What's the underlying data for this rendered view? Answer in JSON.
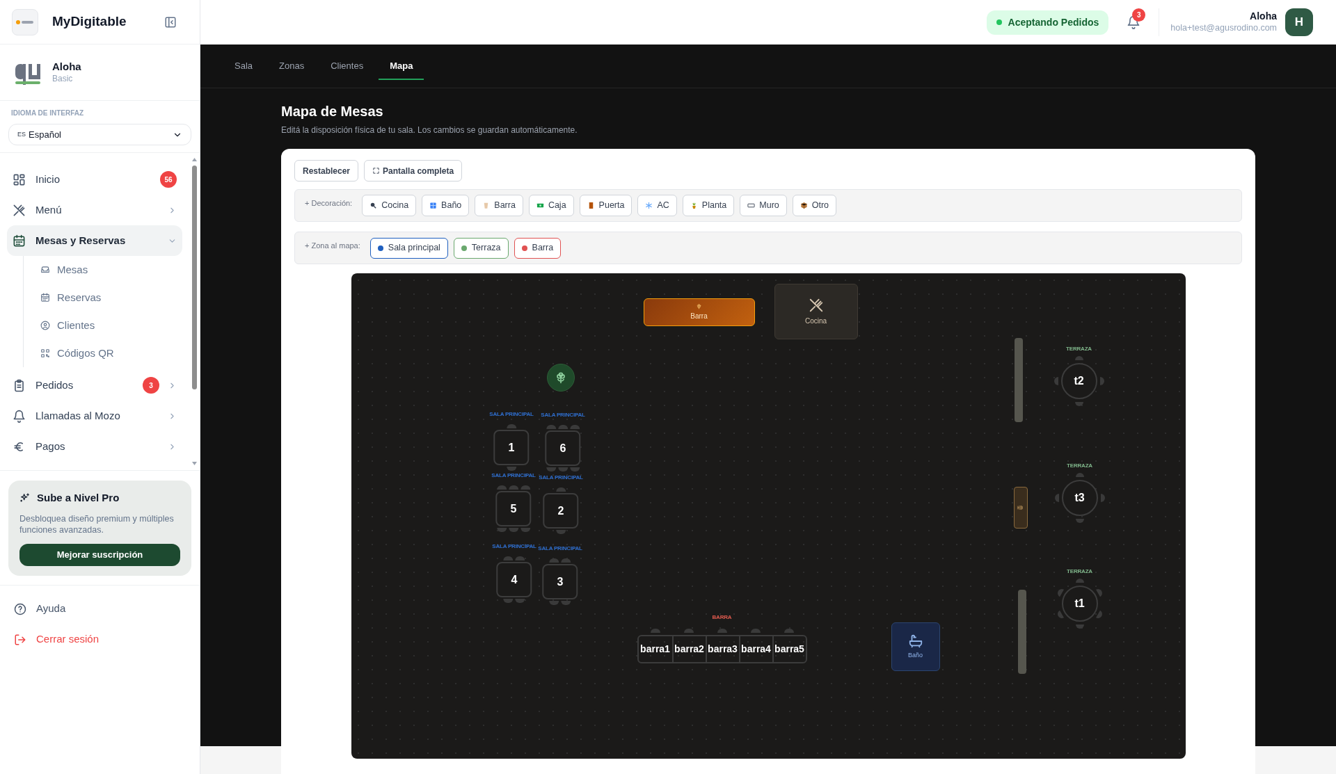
{
  "app": {
    "name": "MyDigitable"
  },
  "sidebar": {
    "restaurant": {
      "name": "Aloha",
      "plan": "Basic"
    },
    "language": {
      "label": "IDIOMA DE INTERFAZ",
      "code": "ES",
      "value": "Español"
    },
    "nav": [
      {
        "label": "Inicio",
        "badge": "56",
        "selected": false
      },
      {
        "label": "Menú",
        "selected": false,
        "expanded": false
      },
      {
        "label": "Mesas y Reservas",
        "selected": true,
        "expanded": true,
        "children": [
          {
            "label": "Mesas"
          },
          {
            "label": "Reservas"
          },
          {
            "label": "Clientes"
          },
          {
            "label": "Códigos QR"
          }
        ]
      },
      {
        "label": "Pedidos",
        "badge": "3",
        "selected": false,
        "expanded": false
      },
      {
        "label": "Llamadas al Mozo",
        "selected": false,
        "expanded": false
      },
      {
        "label": "Pagos",
        "selected": false,
        "expanded": false
      }
    ],
    "promo": {
      "title": "Sube a Nivel Pro",
      "text": "Desbloquea diseño premium y múltiples funciones avanzadas.",
      "button": "Mejorar suscripción"
    },
    "footer": [
      {
        "label": "Ayuda",
        "kind": "normal"
      },
      {
        "label": "Cerrar sesión",
        "kind": "danger"
      }
    ]
  },
  "header": {
    "status": "Aceptando Pedidos",
    "notifications": "3",
    "user": {
      "name": "Aloha",
      "email": "hola+test@agusrodino.com",
      "initial": "H"
    }
  },
  "tabs": [
    {
      "label": "Sala",
      "selected": false
    },
    {
      "label": "Zonas",
      "selected": false
    },
    {
      "label": "Clientes",
      "selected": false
    },
    {
      "label": "Mapa",
      "selected": true
    }
  ],
  "page": {
    "title": "Mapa de Mesas",
    "subtitle": "Editá la disposición física de tu sala. Los cambios se guardan automáticamente.",
    "actions": [
      "Restablecer",
      "Pantalla completa"
    ],
    "decoration": {
      "label": "+ Decoración:",
      "items": [
        "Cocina",
        "Baño",
        "Barra",
        "Caja",
        "Puerta",
        "AC",
        "Planta",
        "Muro",
        "Otro"
      ]
    },
    "zones": {
      "label": "+ Zona al mapa:",
      "items": [
        {
          "label": "Sala principal",
          "color": "#1f5fbf"
        },
        {
          "label": "Terraza",
          "color": "#6aa86e"
        },
        {
          "label": "Barra",
          "color": "#e05252"
        }
      ]
    },
    "map": {
      "items": [
        {
          "kind": "bar_decor",
          "label": "Barra"
        },
        {
          "kind": "kitchen",
          "label": "Cocina"
        },
        {
          "kind": "wall"
        },
        {
          "kind": "round_table",
          "label": "t2",
          "zone": {
            "label": "TERRAZA",
            "color": "#7fb58a"
          }
        },
        {
          "kind": "plant"
        },
        {
          "kind": "square_table",
          "label": "1",
          "zone": {
            "label": "SALA PRINCIPAL",
            "color": "#2f6fd0"
          }
        },
        {
          "kind": "square_table",
          "label": "6",
          "zone": {
            "label": "SALA PRINCIPAL",
            "color": "#2f6fd0"
          }
        },
        {
          "kind": "square_table",
          "label": "5",
          "zone": {
            "label": "SALA PRINCIPAL",
            "color": "#2f6fd0"
          }
        },
        {
          "kind": "square_table",
          "label": "2",
          "zone": {
            "label": "SALA PRINCIPAL",
            "color": "#2f6fd0"
          }
        },
        {
          "kind": "door"
        },
        {
          "kind": "round_table",
          "label": "t3",
          "zone": {
            "label": "TERRAZA",
            "color": "#7fb58a"
          }
        },
        {
          "kind": "square_table",
          "label": "4",
          "zone": {
            "label": "SALA PRINCIPAL",
            "color": "#2f6fd0"
          }
        },
        {
          "kind": "square_table",
          "label": "3",
          "zone": {
            "label": "SALA PRINCIPAL",
            "color": "#2f6fd0"
          }
        },
        {
          "kind": "round_table",
          "label": "t1",
          "zone": {
            "label": "TERRAZA",
            "color": "#7fb58a"
          }
        },
        {
          "kind": "wall"
        },
        {
          "kind": "bar_counter",
          "zone": {
            "label": "BARRA",
            "color": "#e05a4e"
          },
          "seats": [
            "barra1",
            "barra2",
            "barra3",
            "barra4",
            "barra5"
          ]
        },
        {
          "kind": "bathroom",
          "label": "Baño"
        }
      ]
    }
  }
}
